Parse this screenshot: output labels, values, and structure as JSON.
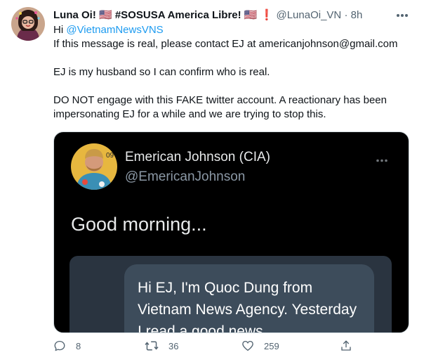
{
  "tweet": {
    "display_name": "Luna Oi! 🇺🇸 #SOSUSA America Libre! 🇺🇸 ❗",
    "handle": "@LunaOi_VN",
    "separator": "·",
    "time": "8h",
    "reply_prefix": "Hi ",
    "reply_mention": "@VietnamNewsVNS",
    "line1": "If this message is real, please contact EJ at americanjohnson@gmail.com",
    "line2": "EJ is my husband so I can confirm who is real.",
    "line3": "DO NOT engage with this FAKE twitter account. A reactionary has been impersonating EJ for a while and we are trying to stop this."
  },
  "embedded": {
    "name": "Emerican Johnson (CIA)",
    "handle": "@EmericanJohnson",
    "text": "Good morning...",
    "chat_message": "Hi EJ, I'm Quoc Dung from Vietnam News Agency. Yesterday I read a good news"
  },
  "actions": {
    "reply_count": "8",
    "retweet_count": "36",
    "like_count": "259"
  },
  "icons": {
    "more": "more-horizontal-icon",
    "reply": "reply-icon",
    "retweet": "retweet-icon",
    "like": "heart-icon",
    "share": "share-icon"
  },
  "colors": {
    "link": "#1d9bf0",
    "muted": "#536471",
    "media_bg": "#000000"
  }
}
